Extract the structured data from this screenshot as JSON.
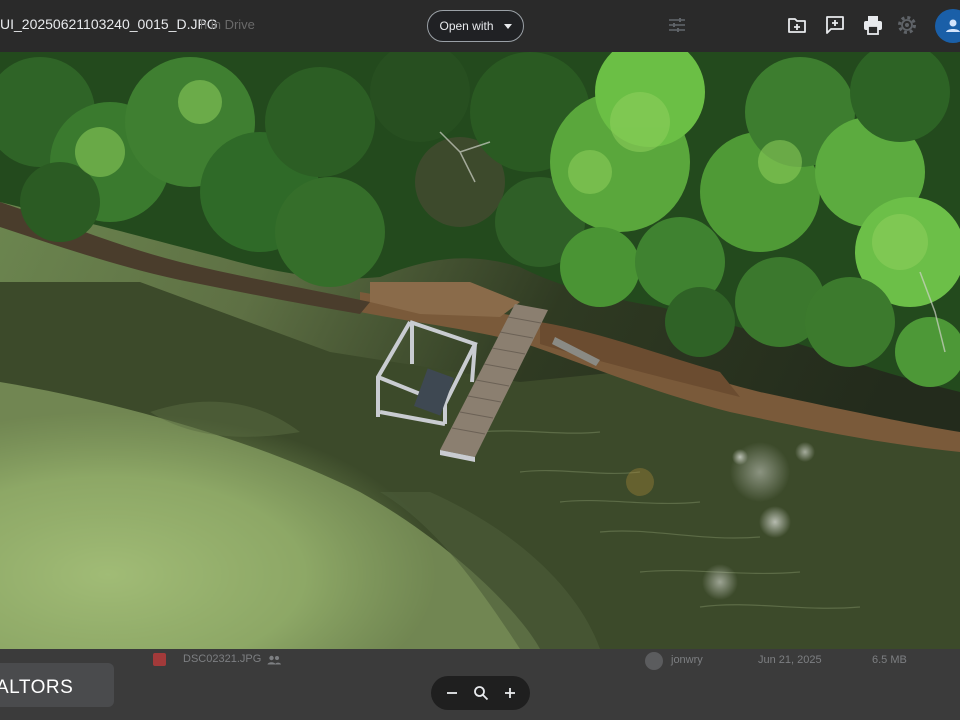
{
  "header": {
    "file_name": "UI_20250621103240_0015_D.JPG",
    "ghost_title": "h in Drive",
    "open_with_label": "Open with"
  },
  "toolbar": {
    "icons": [
      "add-to-drive-icon",
      "add-comment-icon",
      "print-icon",
      "settings-icon"
    ],
    "avatar_color": "#1a5fa8"
  },
  "file_row": {
    "name": "DSC02321.JPG",
    "owner": "jonwry",
    "modified": "Jun 21, 2025",
    "size": "6.5 MB"
  },
  "left_panel": {
    "label": "ALTORS"
  },
  "zoom": {
    "icons": [
      "zoom-out-icon",
      "zoom-icon",
      "zoom-in-icon"
    ]
  },
  "colors": {
    "topbar": "#2a2a2a",
    "background": "#3a3a3a",
    "accent": "#1a5fa8"
  }
}
